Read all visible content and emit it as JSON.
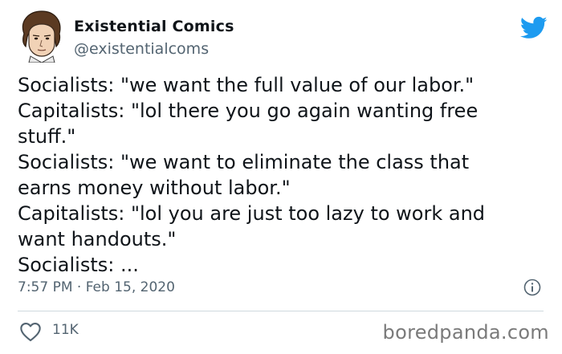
{
  "author": {
    "name": "Existential Comics",
    "handle": "@existentialcoms",
    "avatar_icon": "avatar-illustration",
    "platform_icon": "twitter-bird-icon",
    "platform_color": "#1d9bf0"
  },
  "tweet": {
    "lines": [
      "Socialists: \"we want the full value of our labor.\"",
      "Capitalists: \"lol there you go again wanting free",
      "stuff.\"",
      "Socialists: \"we want to eliminate the class that",
      "earns money without labor.\"",
      "Capitalists: \"lol you are just too lazy to work and",
      "want handouts.\"",
      "Socialists: ..."
    ]
  },
  "meta": {
    "timestamp": "7:57 PM · Feb 15, 2020",
    "info_icon": "info-icon"
  },
  "actions": {
    "like_icon": "heart-icon",
    "like_count": "11K"
  },
  "watermark": "boredpanda.com"
}
